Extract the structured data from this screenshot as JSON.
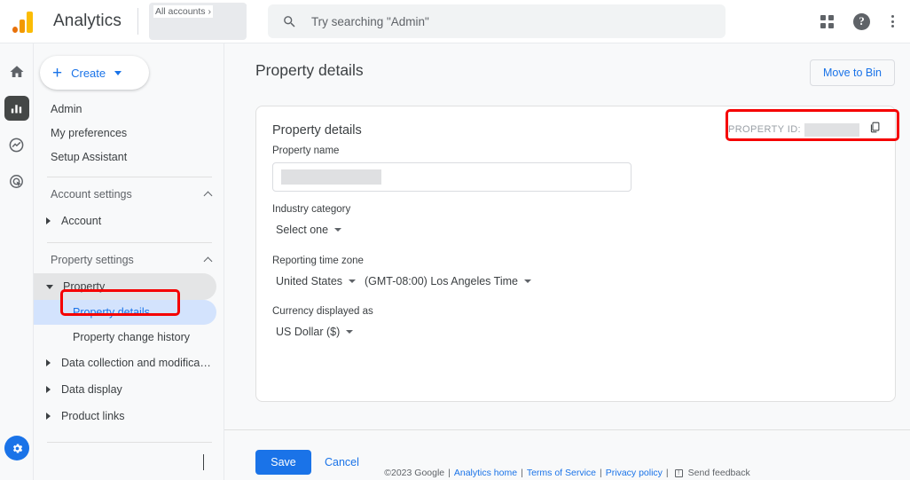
{
  "topbar": {
    "brand": "Analytics",
    "logo_icon": "analytics-logo-icon",
    "account_selector": {
      "label": "All accounts ›",
      "redacted": true
    },
    "search": {
      "placeholder": "Try searching \"Admin\"",
      "icon": "search-icon",
      "value": ""
    },
    "icons": {
      "apps": "apps-grid-icon",
      "help": "?",
      "more": "kebab-menu-icon"
    }
  },
  "rail": {
    "items": [
      {
        "name": "home",
        "icon": "home-icon",
        "active": false
      },
      {
        "name": "reports",
        "icon": "reports-bar-chart-icon",
        "active": true
      },
      {
        "name": "explore",
        "icon": "explore-icon",
        "active": false
      },
      {
        "name": "advertising",
        "icon": "advertising-target-icon",
        "active": false
      }
    ],
    "admin_fab": {
      "name": "admin-gear",
      "icon": "gear-icon"
    }
  },
  "nav": {
    "create_button": {
      "label": "Create",
      "icon": "plus-icon",
      "caret": "chevron-down-icon"
    },
    "top_links": [
      "Admin",
      "My preferences",
      "Setup Assistant"
    ],
    "account_settings": {
      "header": "Account settings",
      "expanded": true,
      "items": [
        "Account"
      ]
    },
    "property_settings": {
      "header": "Property settings",
      "expanded": true,
      "property": {
        "label": "Property",
        "expanded": true,
        "selected_parent": true
      },
      "property_children": [
        "Property details",
        "Property change history"
      ],
      "selected_child": "Property details",
      "other_items": [
        "Data collection and modifica…",
        "Data display",
        "Product links"
      ]
    },
    "collapse_icon": "chevron-left-icon"
  },
  "main": {
    "page_title": "Property details",
    "move_to_bin": "Move to Bin",
    "card": {
      "title": "Property details",
      "property_id": {
        "label": "PROPERTY ID:",
        "value_redacted": true,
        "copy_icon": "copy-icon"
      },
      "fields": {
        "property_name": {
          "label": "Property name",
          "value_redacted": true
        },
        "industry_category": {
          "label": "Industry category",
          "value": "Select one"
        },
        "reporting_time_zone": {
          "label": "Reporting time zone",
          "country": "United States",
          "zone": "(GMT-08:00) Los Angeles Time"
        },
        "currency": {
          "label": "Currency displayed as",
          "value": "US Dollar ($)"
        }
      }
    },
    "save": "Save",
    "cancel": "Cancel",
    "footer": {
      "copyright": "©2023 Google",
      "sep": "|",
      "links": [
        "Analytics home",
        "Terms of Service",
        "Privacy policy"
      ],
      "feedback": "Send feedback",
      "feedback_icon": "feedback-icon"
    }
  },
  "annotations": {
    "accent_color": "#f50000",
    "boxes": [
      "property-id-highlight",
      "property-details-nav-highlight"
    ]
  }
}
